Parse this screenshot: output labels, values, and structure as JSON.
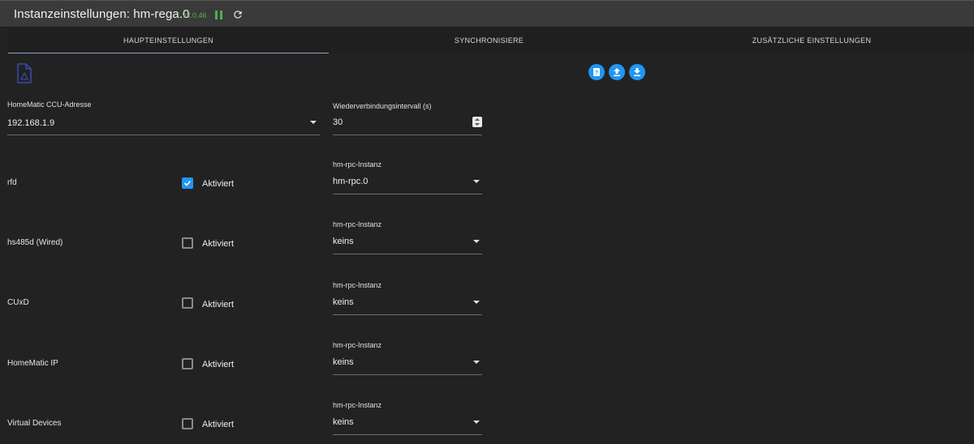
{
  "header": {
    "title": "Instanzeinstellungen: hm-rega.0",
    "version": "v3.0.46"
  },
  "tabs": [
    {
      "label": "HAUPTEINSTELLUNGEN",
      "active": true
    },
    {
      "label": "SYNCHRONISIERE",
      "active": false
    },
    {
      "label": "ZUSÄTZLICHE EINSTELLUNGEN",
      "active": false
    }
  ],
  "toolbar": {
    "icons": [
      "help-icon",
      "upload-icon",
      "download-icon"
    ],
    "accent": "#2196f3"
  },
  "ccu": {
    "label": "HomeMatic CCU-Adresse",
    "value": "192.168.1.9"
  },
  "reconnect": {
    "label": "Wiederverbindungsintervall (s)",
    "value": "30"
  },
  "rows": [
    {
      "name": "rfd",
      "checkbox_label": "Aktiviert",
      "checked": true,
      "instance_label": "hm-rpc-Instanz",
      "instance_value": "hm-rpc.0"
    },
    {
      "name": "hs485d (Wired)",
      "checkbox_label": "Aktiviert",
      "checked": false,
      "instance_label": "hm-rpc-Instanz",
      "instance_value": "keins"
    },
    {
      "name": "CUxD",
      "checkbox_label": "Aktiviert",
      "checked": false,
      "instance_label": "hm-rpc-Instanz",
      "instance_value": "keins"
    },
    {
      "name": "HomeMatic IP",
      "checkbox_label": "Aktiviert",
      "checked": false,
      "instance_label": "hm-rpc-Instanz",
      "instance_value": "keins"
    },
    {
      "name": "Virtual Devices",
      "checkbox_label": "Aktiviert",
      "checked": false,
      "instance_label": "hm-rpc-Instanz",
      "instance_value": "keins"
    }
  ]
}
